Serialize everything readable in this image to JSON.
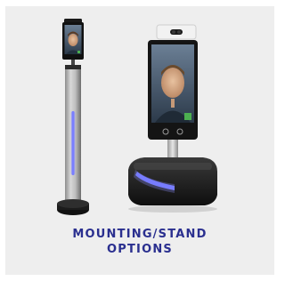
{
  "tile": {
    "caption_line1": "MOUNTING/STAND",
    "caption_line2": "OPTIONS"
  },
  "image": {
    "subject": "two facial-recognition temperature kiosks on stands",
    "floor_stand_icon": "floor-stand-kiosk-icon",
    "desktop_stand_icon": "desktop-stand-kiosk-icon",
    "accent_color": "#6f75ff",
    "caption_color": "#2a2f8f"
  }
}
